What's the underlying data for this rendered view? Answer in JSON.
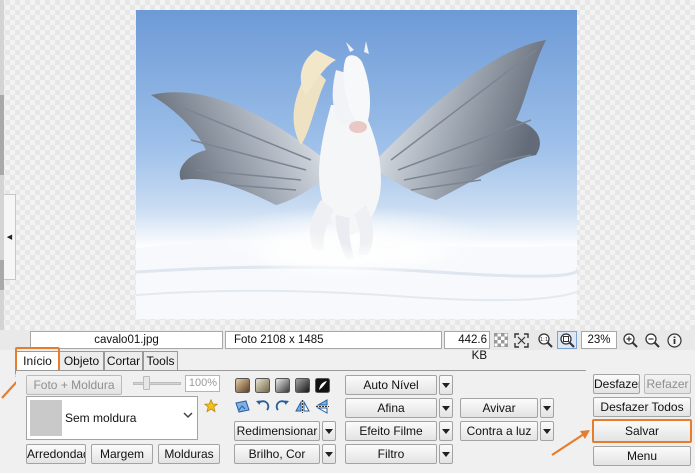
{
  "status_bar": {
    "filename": "cavalo01.jpg",
    "dimensions": "Foto 2108 x 1485",
    "file_size": "442.6 KB",
    "zoom": "23%"
  },
  "tabs": [
    {
      "label": "Início",
      "active": true
    },
    {
      "label": "Objeto",
      "active": false
    },
    {
      "label": "Cortar",
      "active": false
    },
    {
      "label": "Tools",
      "active": false
    }
  ],
  "frame_section": {
    "photo_frame_button": "Foto + Moldura",
    "zoom_value": "100%",
    "frame_select_value": "Sem moldura",
    "rounded_button": "Arredondado",
    "margin_button": "Margem",
    "frames_button": "Molduras"
  },
  "adjust_section": {
    "resize": "Redimensionar",
    "brightness": "Brilho, Cor",
    "auto_level": "Auto Nível",
    "sharpen": "Afina",
    "film_effect": "Efeito Filme",
    "filter": "Filtro",
    "enliven": "Avivar",
    "backlight": "Contra a luz"
  },
  "right_buttons": {
    "undo": "Desfazer",
    "redo": "Refazer",
    "undo_all": "Desfazer Todos",
    "save": "Salvar",
    "menu": "Menu"
  },
  "icons": {
    "tone_swatches": [
      "sepia-tone-icon",
      "warm-tone-icon",
      "gray-tone-icon",
      "dark-tone-icon",
      "negative-icon"
    ],
    "transform": [
      "picture-icon",
      "rotate-left-icon",
      "rotate-right-icon",
      "flip-horizontal-icon",
      "flip-vertical-icon"
    ],
    "status": [
      "checkerboard-icon",
      "fit-icon",
      "zoom-100-icon",
      "zoom-fit-icon",
      "zoom-in-icon",
      "zoom-out-icon",
      "info-icon"
    ]
  },
  "colors": {
    "highlight": "#e57d2d",
    "favorite_star": "#f2c21b"
  }
}
